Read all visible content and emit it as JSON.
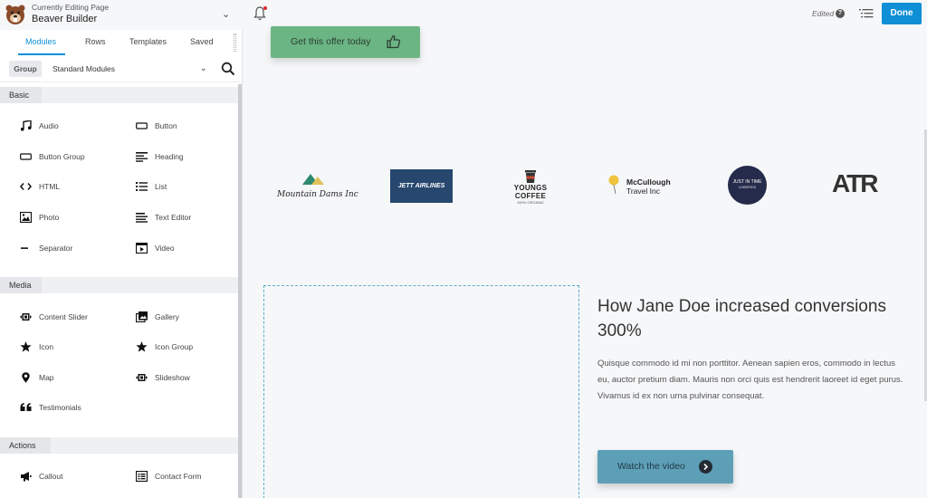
{
  "header": {
    "sub_label": "Currently Editing Page",
    "title": "Beaver Builder",
    "edited_label": "Edited",
    "help_glyph": "?",
    "done_label": "Done"
  },
  "sidebar": {
    "tabs": [
      {
        "label": "Modules",
        "active": true
      },
      {
        "label": "Rows",
        "active": false
      },
      {
        "label": "Templates",
        "active": false
      },
      {
        "label": "Saved",
        "active": false
      }
    ],
    "group_label": "Group",
    "group_select": "Standard Modules",
    "sections": [
      {
        "title": "Basic",
        "modules": [
          {
            "label": "Audio",
            "icon": "music-note-icon"
          },
          {
            "label": "Button",
            "icon": "button-icon"
          },
          {
            "label": "Button Group",
            "icon": "button-group-icon"
          },
          {
            "label": "Heading",
            "icon": "heading-icon"
          },
          {
            "label": "HTML",
            "icon": "code-icon"
          },
          {
            "label": "List",
            "icon": "list-icon"
          },
          {
            "label": "Photo",
            "icon": "photo-icon"
          },
          {
            "label": "Text Editor",
            "icon": "text-editor-icon"
          },
          {
            "label": "Separator",
            "icon": "separator-icon"
          },
          {
            "label": "Video",
            "icon": "video-icon"
          }
        ]
      },
      {
        "title": "Media",
        "modules": [
          {
            "label": "Content Slider",
            "icon": "slider-icon"
          },
          {
            "label": "Gallery",
            "icon": "gallery-icon"
          },
          {
            "label": "Icon",
            "icon": "star-icon"
          },
          {
            "label": "Icon Group",
            "icon": "star-icon"
          },
          {
            "label": "Map",
            "icon": "map-pin-icon"
          },
          {
            "label": "Slideshow",
            "icon": "slideshow-icon"
          },
          {
            "label": "Testimonials",
            "icon": "quote-icon"
          }
        ]
      },
      {
        "title": "Actions",
        "modules": [
          {
            "label": "Callout",
            "icon": "megaphone-icon"
          },
          {
            "label": "Contact Form",
            "icon": "form-icon"
          }
        ]
      }
    ]
  },
  "canvas": {
    "offer_button": "Get this offer today",
    "logos": {
      "mountain": "Mountain Dams Inc",
      "jett": "JETT AIRLINES",
      "youngs": "YOUNGS COFFEE",
      "youngs_sub": "100% ORGANIC",
      "mccullough_1": "McCullough",
      "mccullough_2": "Travel Inc",
      "jit_1": "JUST IN TIME",
      "jit_2": "LOGISTICS",
      "atr": "ATR"
    },
    "case_title": "How Jane Doe increased conversions 300%",
    "case_body": "Quisque commodo id mi non porttitor. Aenean sapien eros, commodo in lectus eu, auctor pretium diam. Mauris non orci quis est hendrerit laoreet id eget purus. Vivamus id ex non urna pulvinar consequat.",
    "watch_button": "Watch the video"
  },
  "colors": {
    "accent": "#0e8fd6",
    "offer_button": "#6bb584",
    "watch_button": "#5d9fb7",
    "jett_bg": "#27476e",
    "jit_bg": "#252b4a"
  }
}
